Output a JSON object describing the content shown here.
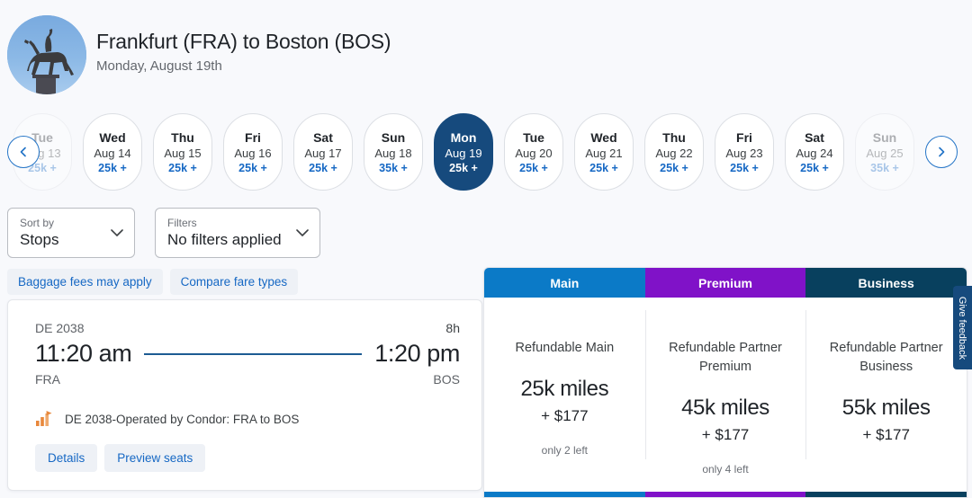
{
  "header": {
    "avatar_icon": "equestrian-statue-photo",
    "route": "Frankfurt (FRA) to Boston (BOS)",
    "date": "Monday, August 19th"
  },
  "carousel": {
    "prev_icon": "chevron-left-icon",
    "next_icon": "chevron-right-icon",
    "days": [
      {
        "dow": "Tue",
        "date": "Aug 13",
        "miles": "25k +",
        "state": "faded"
      },
      {
        "dow": "Wed",
        "date": "Aug 14",
        "miles": "25k +",
        "state": "normal"
      },
      {
        "dow": "Thu",
        "date": "Aug 15",
        "miles": "25k +",
        "state": "normal"
      },
      {
        "dow": "Fri",
        "date": "Aug 16",
        "miles": "25k +",
        "state": "normal"
      },
      {
        "dow": "Sat",
        "date": "Aug 17",
        "miles": "25k +",
        "state": "normal"
      },
      {
        "dow": "Sun",
        "date": "Aug 18",
        "miles": "35k +",
        "state": "normal"
      },
      {
        "dow": "Mon",
        "date": "Aug 19",
        "miles": "25k +",
        "state": "selected"
      },
      {
        "dow": "Tue",
        "date": "Aug 20",
        "miles": "25k +",
        "state": "normal"
      },
      {
        "dow": "Wed",
        "date": "Aug 21",
        "miles": "25k +",
        "state": "normal"
      },
      {
        "dow": "Thu",
        "date": "Aug 22",
        "miles": "25k +",
        "state": "normal"
      },
      {
        "dow": "Fri",
        "date": "Aug 23",
        "miles": "25k +",
        "state": "normal"
      },
      {
        "dow": "Sat",
        "date": "Aug 24",
        "miles": "25k +",
        "state": "normal"
      },
      {
        "dow": "Sun",
        "date": "Aug 25",
        "miles": "35k +",
        "state": "faded"
      }
    ]
  },
  "controls": {
    "sort": {
      "label": "Sort by",
      "value": "Stops",
      "icon": "chevron-down-icon"
    },
    "filters": {
      "label": "Filters",
      "value": "No filters applied",
      "icon": "chevron-down-icon"
    }
  },
  "chips": [
    {
      "label": "Baggage fees may apply"
    },
    {
      "label": "Compare fare types"
    }
  ],
  "flight": {
    "flight_number": "DE 2038",
    "duration": "8h",
    "depart_time": "11:20 am",
    "arrive_time": "1:20 pm",
    "depart_code": "FRA",
    "arrive_code": "BOS",
    "operated_icon": "condor-airline-logo",
    "operated_by": "DE 2038-Operated by Condor: FRA to BOS",
    "details_label": "Details",
    "preview_seats_label": "Preview seats"
  },
  "fares": {
    "tabs": [
      {
        "label": "Main",
        "color": "#0b7ac7"
      },
      {
        "label": "Premium",
        "color": "#8012c8"
      },
      {
        "label": "Business",
        "color": "#08405e"
      }
    ],
    "columns": [
      {
        "name": "Refundable Main",
        "miles": "25k miles",
        "cash": "+ $177",
        "seats_left": "only 2 left"
      },
      {
        "name": "Refundable Partner Premium",
        "miles": "45k miles",
        "cash": "+ $177",
        "seats_left": "only 4 left"
      },
      {
        "name": "Refundable Partner Business",
        "miles": "55k miles",
        "cash": "+ $177",
        "seats_left": ""
      }
    ]
  },
  "feedback": {
    "label": "Give feedback"
  },
  "colors": {
    "page_background": "#f8f9fc",
    "selected_day": "#164a7d",
    "link_blue": "#1668c4",
    "main_tab": "#0b7ac7",
    "premium_tab": "#8012c8",
    "business_tab": "#08405e",
    "condor_orange": "#e8883c"
  }
}
